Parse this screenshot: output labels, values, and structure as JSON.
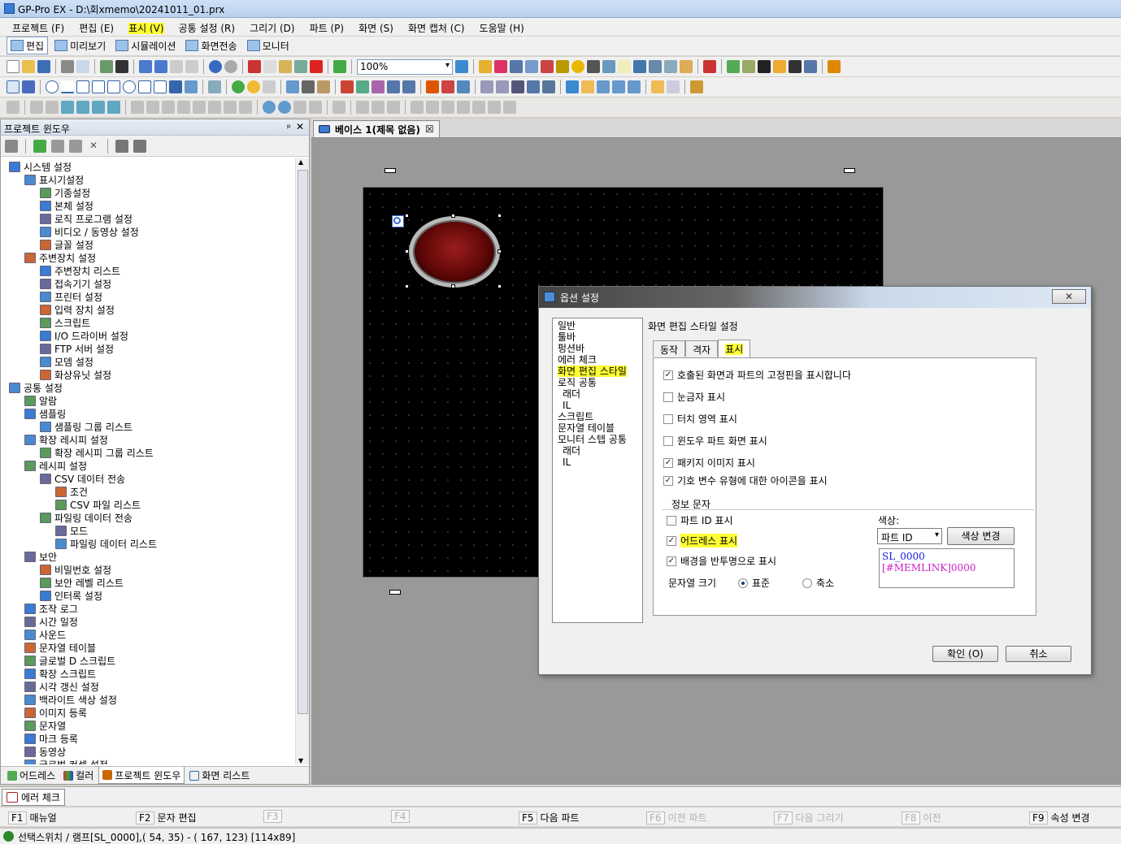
{
  "window": {
    "title": "GP-Pro EX - D:\\회xmemo\\20241011_01.prx"
  },
  "menu": [
    "프로젝트 (F)",
    "편집 (E)",
    "표시 (V)",
    "공통 설정 (R)",
    "그리기 (D)",
    "파트 (P)",
    "화면 (S)",
    "화면 캡처 (C)",
    "도움말 (H)"
  ],
  "mode_tabs": [
    "편집",
    "미리보기",
    "시뮬레이션",
    "화면전송",
    "모니터"
  ],
  "toolbar": {
    "zoom": "100%"
  },
  "project_window": {
    "title": "프로젝트 윈도우",
    "pin": "ᵖ",
    "close": "✕",
    "tree": [
      {
        "label": "시스템 설정",
        "level": 0
      },
      {
        "label": "표시기설정",
        "level": 1
      },
      {
        "label": "기종설정",
        "level": 2
      },
      {
        "label": "본체 설정",
        "level": 2
      },
      {
        "label": "로직 프로그램 설정",
        "level": 2
      },
      {
        "label": "비디오 / 동영상 설정",
        "level": 2
      },
      {
        "label": "글꼴 설정",
        "level": 2
      },
      {
        "label": "주변장치 설정",
        "level": 1
      },
      {
        "label": "주변장치 리스트",
        "level": 2
      },
      {
        "label": "접속기기 설정",
        "level": 2
      },
      {
        "label": "프린터 설정",
        "level": 2
      },
      {
        "label": "입력 장치 설정",
        "level": 2
      },
      {
        "label": "스크립트",
        "level": 2
      },
      {
        "label": "I/O 드라이버 설정",
        "level": 2
      },
      {
        "label": "FTP 서버 설정",
        "level": 2
      },
      {
        "label": "모뎀 설정",
        "level": 2
      },
      {
        "label": "화상유닛 설정",
        "level": 2
      },
      {
        "label": "공통 설정",
        "level": 0
      },
      {
        "label": "알람",
        "level": 1
      },
      {
        "label": "샘플링",
        "level": 1
      },
      {
        "label": "샘플링 그룹 리스트",
        "level": 2
      },
      {
        "label": "확장 레시피 설정",
        "level": 1
      },
      {
        "label": "확장 레시피 그룹 리스트",
        "level": 2
      },
      {
        "label": "레시피 설정",
        "level": 1
      },
      {
        "label": "CSV 데이터 전송",
        "level": 2
      },
      {
        "label": "조건",
        "level": 3
      },
      {
        "label": "CSV 파일 리스트",
        "level": 3
      },
      {
        "label": "파일링 데이터 전송",
        "level": 2
      },
      {
        "label": "모드",
        "level": 3
      },
      {
        "label": "파일링 데이터 리스트",
        "level": 3
      },
      {
        "label": "보안",
        "level": 1
      },
      {
        "label": "비밀번호 설정",
        "level": 2
      },
      {
        "label": "보안 레벨 리스트",
        "level": 2
      },
      {
        "label": "인터록 설정",
        "level": 2
      },
      {
        "label": "조작 로그",
        "level": 1
      },
      {
        "label": "시간 일정",
        "level": 1
      },
      {
        "label": "사운드",
        "level": 1
      },
      {
        "label": "문자열 테이블",
        "level": 1
      },
      {
        "label": "글로벌 D 스크립트",
        "level": 1
      },
      {
        "label": "확장 스크립트",
        "level": 1
      },
      {
        "label": "시각 갱신 설정",
        "level": 1
      },
      {
        "label": "백라이트 색상 설정",
        "level": 1
      },
      {
        "label": "이미지 등록",
        "level": 1
      },
      {
        "label": "문자열",
        "level": 1
      },
      {
        "label": "마크 등록",
        "level": 1
      },
      {
        "label": "동영상",
        "level": 1
      },
      {
        "label": "글로벌 컨셉 설정",
        "level": 1
      }
    ],
    "bottom_tabs": [
      "어드레스",
      "컬러",
      "프로젝트 윈도우",
      "화면 리스트"
    ]
  },
  "editor": {
    "doc_tab": "베이스 1(제목 없음)",
    "doc_close": "☒"
  },
  "dialog": {
    "title": "옵션 설정",
    "close": "✕",
    "categories": [
      "일반",
      "툴바",
      "펑션바",
      "에러 체크",
      "화면 편집 스타일",
      "로직 공통",
      "래더",
      "IL",
      "스크립트",
      "문자열 테이블",
      "모니터 스텝 공통",
      "래더",
      "IL"
    ],
    "section_title": "화면 편집 스타일 설정",
    "tabs": [
      "동작",
      "격자",
      "표시"
    ],
    "options": [
      {
        "label": "호출된 화면과 파트의 고정핀을 표시합니다",
        "checked": "✓"
      },
      {
        "label": "눈금자 표시",
        "checked": ""
      },
      {
        "label": "터치 영역 표시",
        "checked": ""
      },
      {
        "label": "윈도우 파트 화면 표시",
        "checked": ""
      },
      {
        "label": "패키지 이미지 표시",
        "checked": "✓"
      },
      {
        "label": "기호 변수 유형에 대한 아이콘을 표시",
        "checked": "✓"
      }
    ],
    "info_group": "정보 문자",
    "info_options": [
      {
        "label": "파트 ID 표시",
        "checked": ""
      },
      {
        "label": "어드레스 표시",
        "checked": "✓"
      },
      {
        "label": "배경을 반투명으로 표시",
        "checked": "✓"
      }
    ],
    "text_size_label": "문자열 크기",
    "text_size_options": [
      "표준",
      "축소"
    ],
    "color_label": "색상:",
    "color_select": "파트 ID",
    "color_change_button": "색상 변경",
    "preview_line1": "SL_0000",
    "preview_line2": "[#MEMLINK]0000",
    "preview_colors": {
      "line1": "#1a1ad6",
      "line2": "#cc22cc"
    },
    "ok_button": "확인 (O)",
    "cancel_button": "취소"
  },
  "error_tab": "에러 체크",
  "fkeys": [
    {
      "key": "F1",
      "label": "매뉴얼",
      "enabled": true
    },
    {
      "key": "F2",
      "label": "문자 편집",
      "enabled": true
    },
    {
      "key": "F3",
      "label": "",
      "enabled": false
    },
    {
      "key": "F4",
      "label": "",
      "enabled": false
    },
    {
      "key": "F5",
      "label": "다음 파트",
      "enabled": true
    },
    {
      "key": "F6",
      "label": "이전 파트",
      "enabled": false
    },
    {
      "key": "F7",
      "label": "다음 그리기",
      "enabled": false
    },
    {
      "key": "F8",
      "label": "이전",
      "enabled": false
    },
    {
      "key": "F9",
      "label": "속성 변경",
      "enabled": true
    }
  ],
  "status": "선택스위치 / 램프[SL_0000],( 54, 35) - ( 167, 123) [114x89]",
  "colors": {
    "highlight": "#ffff33",
    "canvas": "#000000",
    "workspace": "#999999"
  }
}
